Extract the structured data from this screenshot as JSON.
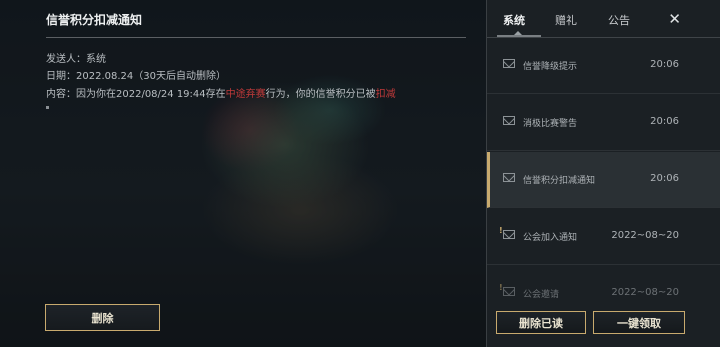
{
  "detail": {
    "title": "信誉积分扣减通知",
    "sender_label": "发送人：",
    "sender": "系统",
    "date_label": "日期：",
    "date": "2022.08.24",
    "date_note": "（30天后自动删除）",
    "content_label": "内容：",
    "content_part1": "因为你在2022/08/24 19:44存在",
    "content_highlight1": "中途弃赛",
    "content_part2": "行为，你的信誉积分已被",
    "content_highlight2": "扣减",
    "delete_label": "删除"
  },
  "panel": {
    "tabs": [
      {
        "label": "系统",
        "active": true
      },
      {
        "label": "赠礼",
        "active": false
      },
      {
        "label": "公告",
        "active": false
      }
    ],
    "close_icon": "close-icon",
    "messages": [
      {
        "name": "信誉降级提示",
        "time": "20:06",
        "icon": "mail-icon"
      },
      {
        "name": "消极比赛警告",
        "time": "20:06",
        "icon": "mail-icon"
      },
      {
        "name": "信誉积分扣减通知",
        "time": "20:06",
        "icon": "mail-icon",
        "selected": true
      },
      {
        "name": "公会加入通知",
        "time": "2022~08~20",
        "icon": "mail-notice-icon"
      },
      {
        "name": "公会邀请",
        "time": "2022~08~20",
        "icon": "mail-notice-icon"
      }
    ],
    "delete_read_label": "删除已读",
    "claim_all_label": "一键领取"
  },
  "colors": {
    "gold_border": "#c8aa6e",
    "highlight_red": "#c23a3a"
  }
}
